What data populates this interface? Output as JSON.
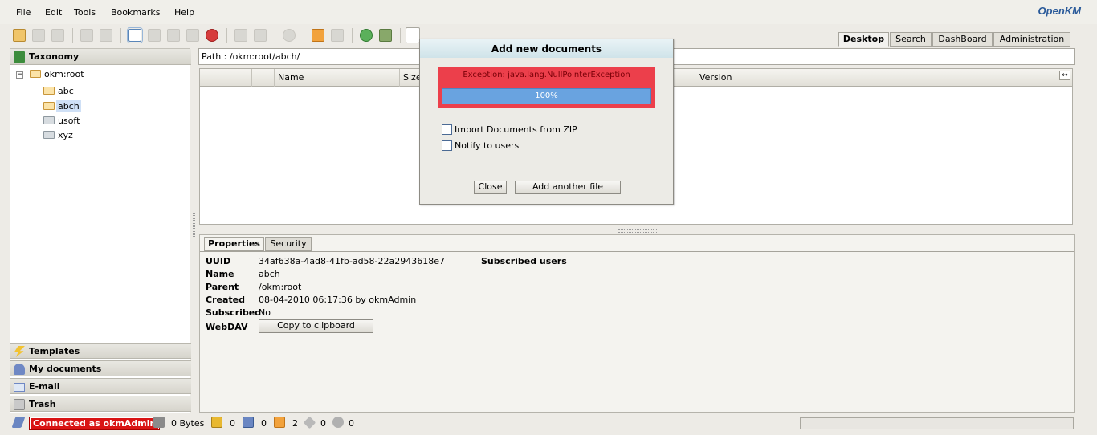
{
  "menu": {
    "items": [
      "File",
      "Edit",
      "Tools",
      "Bookmarks",
      "Help"
    ],
    "logo_main": "penKM",
    "logo_prefix": "O"
  },
  "top_tabs": [
    "Desktop",
    "Search",
    "DashBoard",
    "Administration"
  ],
  "left_panel": {
    "taxonomy_label": "Taxonomy",
    "root": "okm:root",
    "folders": [
      "abc",
      "abch",
      "usoft",
      "xyz"
    ],
    "selected_folder": "abch",
    "bottom_stacks": [
      "Templates",
      "My documents",
      "E-mail",
      "Trash"
    ]
  },
  "path_bar": "Path : /okm:root/abch/",
  "table": {
    "columns": [
      "",
      "",
      "Name",
      "Size",
      "Version"
    ]
  },
  "properties": {
    "tabs": [
      "Properties",
      "Security"
    ],
    "labels": {
      "uuid": "UUID",
      "name": "Name",
      "parent": "Parent",
      "created": "Created",
      "subscribed": "Subscribed",
      "webdav": "WebDAV"
    },
    "values": {
      "uuid": "34af638a-4ad8-41fb-ad58-22a2943618e7",
      "name": "abch",
      "parent": "/okm:root",
      "created": "08-04-2010 06:17:36 by okmAdmin",
      "subscribed": "No"
    },
    "subscribed_users_label": "Subscribed users",
    "copy_button": "Copy to clipboard"
  },
  "status_bar": {
    "connection": "Connected as okmAdmin",
    "size": "0 Bytes",
    "locked_count": "0",
    "checkout_count": "0",
    "subscription_count": "2",
    "news_count": "0",
    "workflow_count": "0"
  },
  "dialog": {
    "title": "Add new documents",
    "error": "Exception: java.lang.NullPointerException",
    "progress_text": "100%",
    "progress_value": 1.0,
    "import_zip_label": "Import Documents from ZIP",
    "notify_label": "Notify to users",
    "close_button": "Close",
    "add_another_button": "Add another file"
  },
  "colors": {
    "error_background": "#ec3f4b",
    "progress_fill": "#69a3e0",
    "connection_badge": "#d91414",
    "selected_item": "#cfe0f6"
  }
}
